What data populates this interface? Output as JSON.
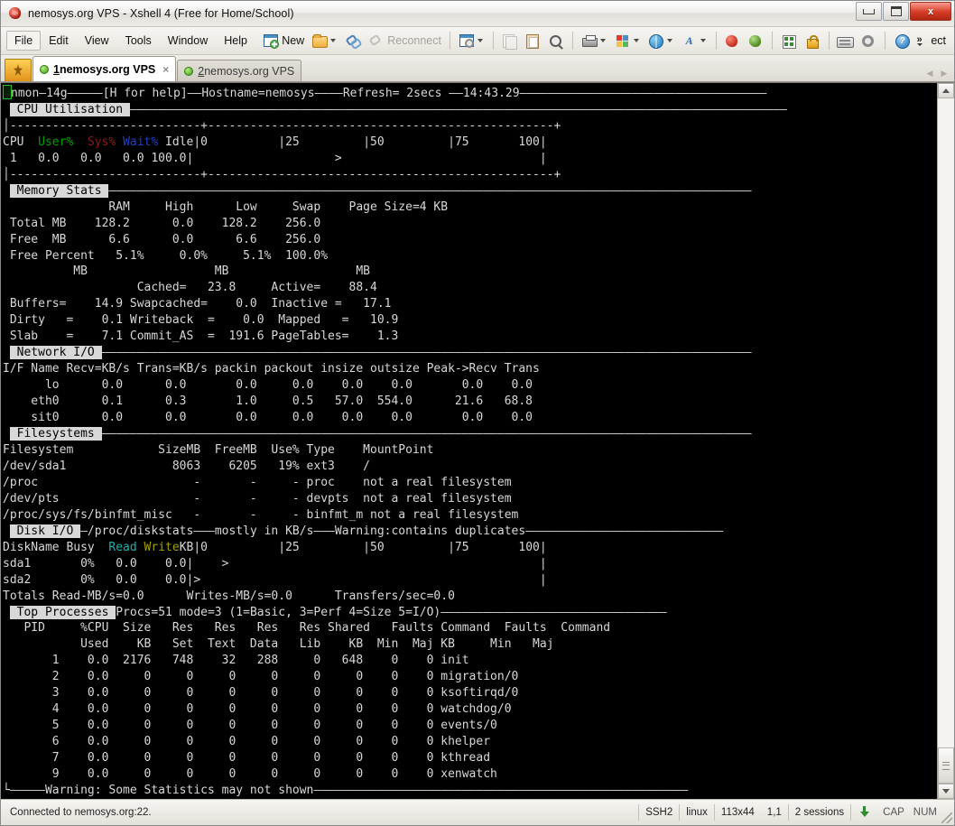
{
  "window": {
    "title": "nemosys.org VPS - Xshell 4 (Free for Home/School)",
    "app_icon": "xshell-icon",
    "minimize_label": "",
    "maximize_label": "",
    "close_label": "x"
  },
  "menubar": {
    "items": [
      "File",
      "Edit",
      "View",
      "Tools",
      "Window",
      "Help"
    ],
    "new_label": "New",
    "reconnect_label": "Reconnect",
    "overflow_label": "ect"
  },
  "toolbar": {
    "icons": [
      "new-session-icon",
      "open-folder-icon",
      "connect-icon",
      "reconnect-icon",
      "session-properties-icon",
      "copy-icon",
      "paste-icon",
      "find-icon",
      "print-icon",
      "color-scheme-icon",
      "web-icon",
      "font-icon",
      "xshell-icon",
      "xftp-icon",
      "transfer-icon",
      "lock-icon",
      "keyboard-icon",
      "options-icon",
      "help-icon"
    ]
  },
  "tabs": [
    {
      "num": "1",
      "label": " nemosys.org VPS",
      "active": true,
      "close": "×"
    },
    {
      "num": "2",
      "label": " nemosys.org VPS",
      "active": false,
      "close": ""
    }
  ],
  "terminal": {
    "lines": [
      [
        {
          "t": "█",
          "c": "cursor"
        },
        {
          "t": "nmon—14g—————[H for help]——Hostname=nemosys————Refresh= 2secs ——14:43.29———————————————————————————————————"
        }
      ],
      [
        {
          "t": " "
        },
        {
          "t": " CPU Utilisation ",
          "c": "inv"
        },
        {
          "t": "—————————————————————————————————————————————————————————————————————————————————————————————"
        }
      ],
      [
        {
          "t": "│---------------------------+-------------------------------------------------+"
        }
      ],
      [
        {
          "t": "CPU  "
        },
        {
          "t": "User%",
          "c": "grn"
        },
        {
          "t": "  "
        },
        {
          "t": "Sys%",
          "c": "red"
        },
        {
          "t": " "
        },
        {
          "t": "Wait%",
          "c": "blu"
        },
        {
          "t": " Idle|0          |25         |50         |75       100|"
        }
      ],
      [
        {
          "t": " 1   0.0   0.0   0.0 100.0|                    >                            |"
        }
      ],
      [
        {
          "t": "│---------------------------+-------------------------------------------------+"
        }
      ],
      [
        {
          "t": " "
        },
        {
          "t": " Memory Stats ",
          "c": "inv"
        },
        {
          "t": "———————————————————————————————————————————————————————————————————————————————————————————"
        }
      ],
      [
        {
          "t": "               RAM     High      Low     Swap    Page Size=4 KB"
        }
      ],
      [
        {
          "t": " Total MB    128.2      0.0    128.2    256.0"
        }
      ],
      [
        {
          "t": " Free  MB      6.6      0.0      6.6    256.0"
        }
      ],
      [
        {
          "t": " Free Percent   5.1%     0.0%     5.1%  100.0%"
        }
      ],
      [
        {
          "t": "          MB                  MB                  MB"
        }
      ],
      [
        {
          "t": "                   Cached=   23.8     Active=    88.4"
        }
      ],
      [
        {
          "t": " Buffers=    14.9 Swapcached=    0.0  Inactive =   17.1"
        }
      ],
      [
        {
          "t": " Dirty   =    0.1 Writeback  =    0.0  Mapped   =   10.9"
        }
      ],
      [
        {
          "t": " Slab    =    7.1 Commit_AS  =  191.6 PageTables=    1.3"
        }
      ],
      [
        {
          "t": " "
        },
        {
          "t": " Network I/O ",
          "c": "inv"
        },
        {
          "t": "————————————————————————————————————————————————————————————————————————————————————————————"
        }
      ],
      [
        {
          "t": "I/F Name Recv=KB/s Trans=KB/s packin packout insize outsize Peak->Recv Trans"
        }
      ],
      [
        {
          "t": "      lo      0.0      0.0       0.0     0.0    0.0    0.0       0.0    0.0"
        }
      ],
      [
        {
          "t": "    eth0      0.1      0.3       1.0     0.5   57.0  554.0      21.6   68.8"
        }
      ],
      [
        {
          "t": "    sit0      0.0      0.0       0.0     0.0    0.0    0.0       0.0    0.0"
        }
      ],
      [
        {
          "t": " "
        },
        {
          "t": " Filesystems ",
          "c": "inv"
        },
        {
          "t": "————————————————————————————————————————————————————————————————————————————————————————————"
        }
      ],
      [
        {
          "t": "Filesystem            SizeMB  FreeMB  Use% Type    MountPoint"
        }
      ],
      [
        {
          "t": "/dev/sda1               8063    6205   19% ext3    /"
        }
      ],
      [
        {
          "t": "/proc                      -       -     - proc    not a real filesystem"
        }
      ],
      [
        {
          "t": "/dev/pts                   -       -     - devpts  not a real filesystem"
        }
      ],
      [
        {
          "t": "/proc/sys/fs/binfmt_misc   -       -     - binfmt_m not a real filesystem"
        }
      ],
      [
        {
          "t": " "
        },
        {
          "t": " Disk I/O ",
          "c": "inv"
        },
        {
          "t": "—/proc/diskstats———mostly in KB/s———Warning:contains duplicates————————————————————————————"
        }
      ],
      [
        {
          "t": "DiskName Busy  "
        },
        {
          "t": "Read",
          "c": "cyn"
        },
        {
          "t": " "
        },
        {
          "t": "Write",
          "c": "yel"
        },
        {
          "t": "KB|0          |25         |50         |75       100|"
        }
      ],
      [
        {
          "t": "sda1       0%   0.0    0.0|    >                                            |"
        }
      ],
      [
        {
          "t": "sda2       0%   0.0    0.0|>                                                |"
        }
      ],
      [
        {
          "t": "Totals Read-MB/s=0.0      Writes-MB/s=0.0      Transfers/sec=0.0"
        }
      ],
      [
        {
          "t": " "
        },
        {
          "t": " Top Processes ",
          "c": "inv"
        },
        {
          "t": "Procs=51 mode=3 (1=Basic, 3=Perf 4=Size 5=I/O)————————————————————————————————"
        }
      ],
      [
        {
          "t": "   PID     %CPU  Size   Res   Res   Res   Res Shared   Faults Command  Faults  Command"
        }
      ],
      [
        {
          "t": "           Used    KB   Set  Text  Data   Lib    KB  Min  Maj KB     Min   Maj"
        }
      ],
      [
        {
          "t": "       1    0.0  2176   748    32   288     0   648    0    0 init"
        }
      ],
      [
        {
          "t": "       2    0.0     0     0     0     0     0     0    0    0 migration/0"
        }
      ],
      [
        {
          "t": "       3    0.0     0     0     0     0     0     0    0    0 ksoftirqd/0"
        }
      ],
      [
        {
          "t": "       4    0.0     0     0     0     0     0     0    0    0 watchdog/0"
        }
      ],
      [
        {
          "t": "       5    0.0     0     0     0     0     0     0    0    0 events/0"
        }
      ],
      [
        {
          "t": "       6    0.0     0     0     0     0     0     0    0    0 khelper"
        }
      ],
      [
        {
          "t": "       7    0.0     0     0     0     0     0     0    0    0 kthread"
        }
      ],
      [
        {
          "t": "       9    0.0     0     0     0     0     0     0    0    0 xenwatch"
        }
      ],
      [
        {
          "t": "└—————Warning: Some Statistics may not shown—————————————————————————————————————————————————————"
        }
      ]
    ],
    "colors": {
      "background": "#000000",
      "foreground": "#d8d8d8",
      "user_pct": "#00a000",
      "sys_pct": "#8b1a1a",
      "wait_pct": "#1e3fd0",
      "read": "#20b2aa",
      "write": "#a0a000",
      "cursor": "#22c022"
    }
  },
  "statusbar": {
    "message": "Connected to nemosys.org:22.",
    "protocol": "SSH2",
    "term_type": "linux",
    "size": "113x44",
    "cursor_pos": "1,1",
    "sessions": "2 sessions",
    "cap": "CAP",
    "num": "NUM"
  }
}
